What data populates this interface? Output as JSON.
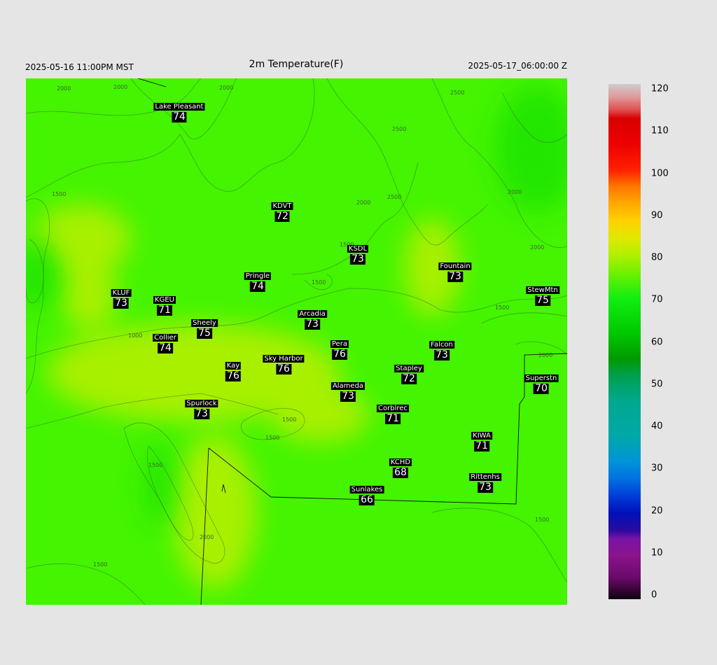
{
  "header": {
    "valid_local": "2025-05-16 11:00PM MST",
    "title": "2m Temperature(F)",
    "valid_utc": "2025-05-17_06:00:00 Z"
  },
  "map": {
    "fill_colors": {
      "main": "#44f400",
      "warm": "#a8f000",
      "cool": "#22e600"
    },
    "contour_labels": [
      "2000",
      "2000",
      "2000",
      "2500",
      "2500",
      "2500",
      "2000",
      "2000",
      "2000",
      "1500",
      "1500",
      "1500",
      "1500",
      "1000",
      "1500",
      "1500",
      "1500",
      "2000",
      "1500",
      "1500",
      "2000"
    ],
    "stations": [
      {
        "name": "Lake Pleasant",
        "value": 74
      },
      {
        "name": "KDVT",
        "value": 72
      },
      {
        "name": "KSDL",
        "value": 73
      },
      {
        "name": "Fountain",
        "value": 73
      },
      {
        "name": "StewMtn",
        "value": 75
      },
      {
        "name": "KLUF",
        "value": 73
      },
      {
        "name": "KGEU",
        "value": 71
      },
      {
        "name": "Pringle",
        "value": 74
      },
      {
        "name": "Arcadia",
        "value": 73
      },
      {
        "name": "Sheely",
        "value": 75
      },
      {
        "name": "Collier",
        "value": 74
      },
      {
        "name": "Pera",
        "value": 76
      },
      {
        "name": "Falcon",
        "value": 73
      },
      {
        "name": "Kay",
        "value": 76
      },
      {
        "name": "Sky Harbor",
        "value": 76
      },
      {
        "name": "Stapley",
        "value": 72
      },
      {
        "name": "Superstn",
        "value": 70
      },
      {
        "name": "Alameda",
        "value": 73
      },
      {
        "name": "Spurlock",
        "value": 73
      },
      {
        "name": "Corblrec",
        "value": 71
      },
      {
        "name": "KIWA",
        "value": 71
      },
      {
        "name": "KCHD",
        "value": 68
      },
      {
        "name": "Rittenhs",
        "value": 73
      },
      {
        "name": "Sunlakes",
        "value": 66
      }
    ]
  },
  "colorbar": {
    "min": 0,
    "max": 120,
    "ticks": [
      "120",
      "110",
      "100",
      "90",
      "80",
      "70",
      "60",
      "50",
      "40",
      "30",
      "20",
      "10",
      "0"
    ],
    "stops": [
      {
        "v": 0,
        "c": "#100010"
      },
      {
        "v": 5,
        "c": "#6a0a6a"
      },
      {
        "v": 10,
        "c": "#8a148a"
      },
      {
        "v": 14,
        "c": "#7a14a6"
      },
      {
        "v": 16,
        "c": "#2c0a9e"
      },
      {
        "v": 20,
        "c": "#0010b8"
      },
      {
        "v": 24,
        "c": "#003cd8"
      },
      {
        "v": 28,
        "c": "#0070e0"
      },
      {
        "v": 32,
        "c": "#0094d8"
      },
      {
        "v": 38,
        "c": "#00a8a8"
      },
      {
        "v": 46,
        "c": "#00a890"
      },
      {
        "v": 52,
        "c": "#00a050"
      },
      {
        "v": 56,
        "c": "#009a00"
      },
      {
        "v": 62,
        "c": "#00c800"
      },
      {
        "v": 70,
        "c": "#10ee10"
      },
      {
        "v": 76,
        "c": "#70f000"
      },
      {
        "v": 80,
        "c": "#b0f000"
      },
      {
        "v": 84,
        "c": "#e0e800"
      },
      {
        "v": 88,
        "c": "#ffd200"
      },
      {
        "v": 92,
        "c": "#ffaa00"
      },
      {
        "v": 96,
        "c": "#ff7a00"
      },
      {
        "v": 100,
        "c": "#ff2000"
      },
      {
        "v": 106,
        "c": "#ee0000"
      },
      {
        "v": 112,
        "c": "#d80000"
      },
      {
        "v": 114,
        "c": "#e05050"
      },
      {
        "v": 117,
        "c": "#e09a9a"
      },
      {
        "v": 120,
        "c": "#cccccc"
      }
    ]
  }
}
